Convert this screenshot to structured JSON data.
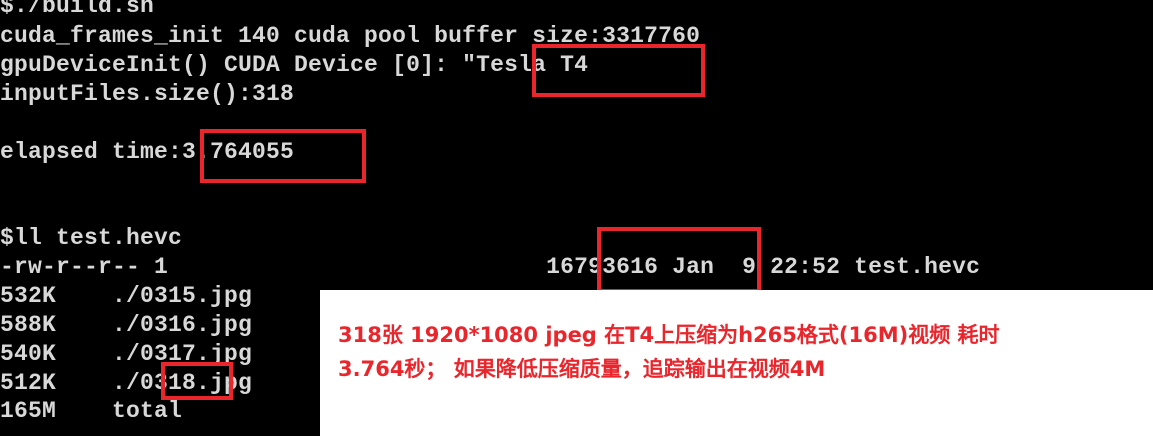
{
  "terminal": {
    "lines": {
      "cmd_build": "$./build.sh",
      "cuda_frames": "cuda_frames_init 140 cuda pool buffer size:3317760",
      "gpu_device": "gpuDeviceInit() CUDA Device [0]: \"Tesla T4",
      "input_files": "inputFiles.size():318",
      "elapsed": "elapsed time:3.764055",
      "cmd_ll": "$ll test.hevc",
      "ll_result": "-rw-r--r-- 1                           16793616 Jan  9 22:52 test.hevc",
      "du_0315": "532K    ./0315.jpg",
      "du_0316": "588K    ./0316.jpg",
      "du_0317": "540K    ./0317.jpg",
      "du_0318": "512K    ./0318.jpg",
      "du_total": "165M    total"
    }
  },
  "annotation": {
    "line1": "318张 1920*1080 jpeg 在T4上压缩为h265格式(16M)视频 耗时",
    "line2": "3.764秒； 如果降低压缩质量，追踪输出在视频4M"
  },
  "colors": {
    "highlight": "#e8262c",
    "terminal_bg": "#000000",
    "terminal_fg": "#d8d8d8"
  }
}
